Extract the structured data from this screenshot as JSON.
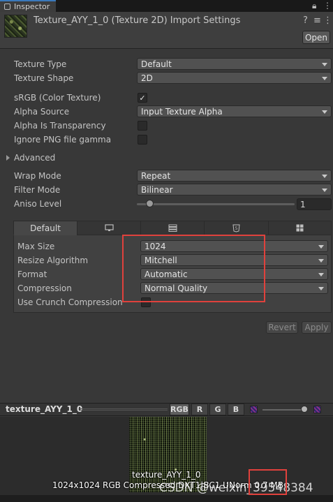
{
  "window": {
    "tab_label": "Inspector"
  },
  "header": {
    "title": "Texture_AYY_1_0 (Texture 2D) Import Settings",
    "open_label": "Open"
  },
  "properties": {
    "texture_type": {
      "label": "Texture Type",
      "value": "Default"
    },
    "texture_shape": {
      "label": "Texture Shape",
      "value": "2D"
    },
    "srgb": {
      "label": "sRGB (Color Texture)",
      "checked": true,
      "mark": "✓"
    },
    "alpha_source": {
      "label": "Alpha Source",
      "value": "Input Texture Alpha"
    },
    "alpha_is_transparency": {
      "label": "Alpha Is Transparency",
      "checked": false
    },
    "ignore_png_gamma": {
      "label": "Ignore PNG file gamma",
      "checked": false
    },
    "advanced": {
      "label": "Advanced"
    },
    "wrap_mode": {
      "label": "Wrap Mode",
      "value": "Repeat"
    },
    "filter_mode": {
      "label": "Filter Mode",
      "value": "Bilinear"
    },
    "aniso_level": {
      "label": "Aniso Level",
      "value": "1"
    }
  },
  "platform": {
    "tabs": [
      {
        "label": "Default",
        "icon": ""
      },
      {
        "label": "",
        "icon": "monitor-icon"
      },
      {
        "label": "",
        "icon": "server-icon"
      },
      {
        "label": "",
        "icon": "html5-icon"
      },
      {
        "label": "",
        "icon": "windows-icon"
      }
    ],
    "max_size": {
      "label": "Max Size",
      "value": "1024"
    },
    "resize_algorithm": {
      "label": "Resize Algorithm",
      "value": "Mitchell"
    },
    "format": {
      "label": "Format",
      "value": "Automatic"
    },
    "compression": {
      "label": "Compression",
      "value": "Normal Quality"
    },
    "use_crunch": {
      "label": "Use Crunch Compression",
      "checked": false
    }
  },
  "actions": {
    "revert_label": "Revert",
    "apply_label": "Apply"
  },
  "preview": {
    "name": "texture_AYY_1_0",
    "channels": [
      "RGB",
      "R",
      "G",
      "B"
    ],
    "caption_name": "texture_AYY_1_0",
    "caption_info": "1024x1024  RGB Compressed DXT1|BC1 UNorm  0.7 MB"
  },
  "watermark": "CSDN @weixin_39548384",
  "colors": {
    "highlight": "#e0413c",
    "accent": "#3a79bb"
  }
}
